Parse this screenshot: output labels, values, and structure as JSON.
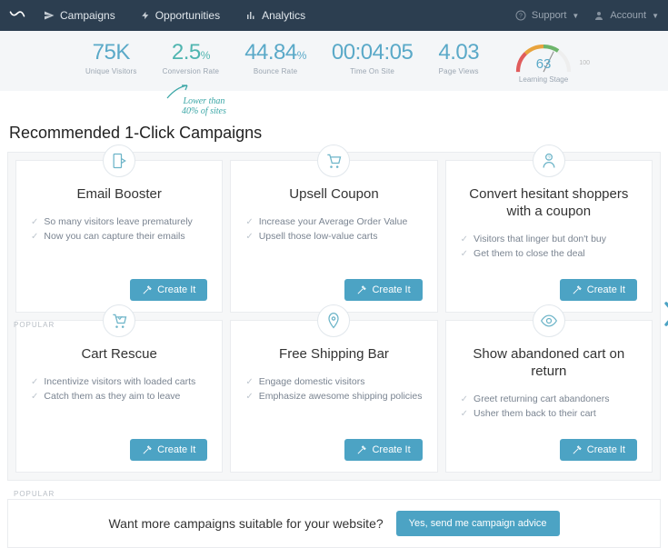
{
  "header": {
    "nav": [
      {
        "label": "Campaigns"
      },
      {
        "label": "Opportunities"
      },
      {
        "label": "Analytics"
      }
    ],
    "support": "Support",
    "account": "Account"
  },
  "metrics": {
    "visitors": {
      "value": "75K",
      "label": "Unique Visitors"
    },
    "conversion": {
      "value": "2.5",
      "unit": "%",
      "label": "Conversion Rate"
    },
    "bounce": {
      "value": "44.84",
      "unit": "%",
      "label": "Bounce Rate"
    },
    "time": {
      "value": "00:04:05",
      "label": "Time On Site"
    },
    "pageviews": {
      "value": "4.03",
      "label": "Page Views"
    },
    "gauge": {
      "value": "63",
      "max": "100",
      "label": "Learning Stage"
    },
    "annotation_line1": "Lower than",
    "annotation_line2": "40% of sites"
  },
  "section_title": "Recommended 1-Click Campaigns",
  "popular_tag": "POPULAR",
  "cards": [
    {
      "title": "Email Booster",
      "b1": "So many visitors leave prematurely",
      "b2": "Now you can capture their emails",
      "cta": "Create It"
    },
    {
      "title": "Upsell Coupon",
      "b1": "Increase your Average Order Value",
      "b2": "Upsell those low-value carts",
      "cta": "Create It"
    },
    {
      "title": "Convert hesitant shoppers with a coupon",
      "b1": "Visitors that linger but don't buy",
      "b2": "Get them to close the deal",
      "cta": "Create It"
    },
    {
      "title": "Cart Rescue",
      "b1": "Incentivize visitors with loaded carts",
      "b2": "Catch them as they aim to leave",
      "cta": "Create It"
    },
    {
      "title": "Free Shipping Bar",
      "b1": "Engage domestic visitors",
      "b2": "Emphasize awesome shipping policies",
      "cta": "Create It"
    },
    {
      "title": "Show abandoned cart on return",
      "b1": "Greet returning cart abandoners",
      "b2": "Usher them back to their cart",
      "cta": "Create It"
    }
  ],
  "bottom": {
    "text": "Want more campaigns suitable for your website?",
    "button": "Yes, send me campaign advice"
  },
  "colors": {
    "accent": "#4ca3c4",
    "header_bg": "#2c3e50",
    "teal": "#4fb5b0"
  }
}
